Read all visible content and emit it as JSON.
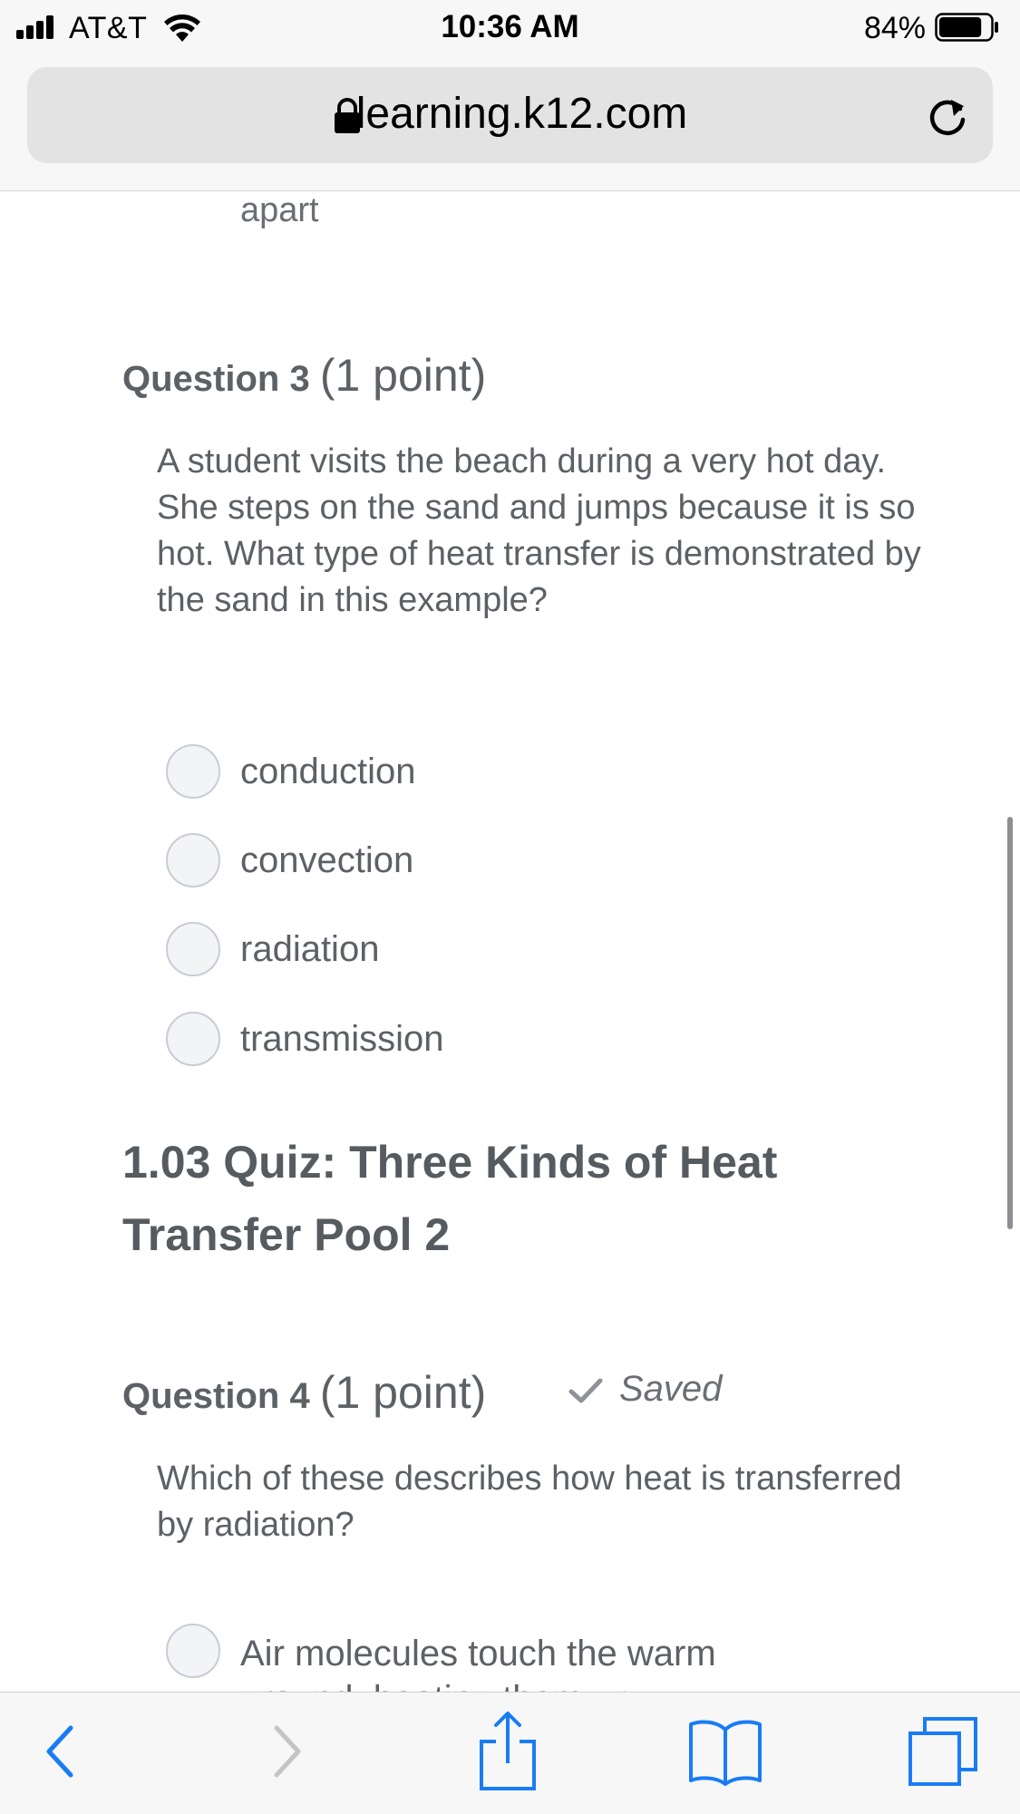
{
  "status_bar": {
    "carrier": "AT&T",
    "time": "10:36 AM",
    "battery_percent": "84%",
    "battery_level": 0.84
  },
  "browser": {
    "url": "learning.k12.com",
    "icons": [
      "lock-icon",
      "reload-icon"
    ],
    "toolbar_icons": [
      "back-icon",
      "forward-icon",
      "share-icon",
      "bookmarks-icon",
      "tabs-icon"
    ],
    "accent_color": "#1a7cf5",
    "forward_disabled_color": "#c4c4c7"
  },
  "previous_question": {
    "answer_tail": "apart"
  },
  "question3": {
    "number_label": "Question 3",
    "points_label": "(1 point)",
    "text": "A student visits the beach during a very hot day. She steps on the sand and jumps because it is so hot. What type of heat transfer is demonstrated by the sand in this example?",
    "options": [
      "conduction",
      "convection",
      "radiation",
      "transmission"
    ]
  },
  "section": {
    "title": "1.03 Quiz: Three Kinds of Heat Transfer Pool 2"
  },
  "question4": {
    "number_label": "Question 4",
    "points_label": "(1 point)",
    "saved_label": "Saved",
    "text": "Which of these describes how heat is transferred by radiation?",
    "options": [
      "Air molecules touch the warm ground, heating them up"
    ]
  }
}
